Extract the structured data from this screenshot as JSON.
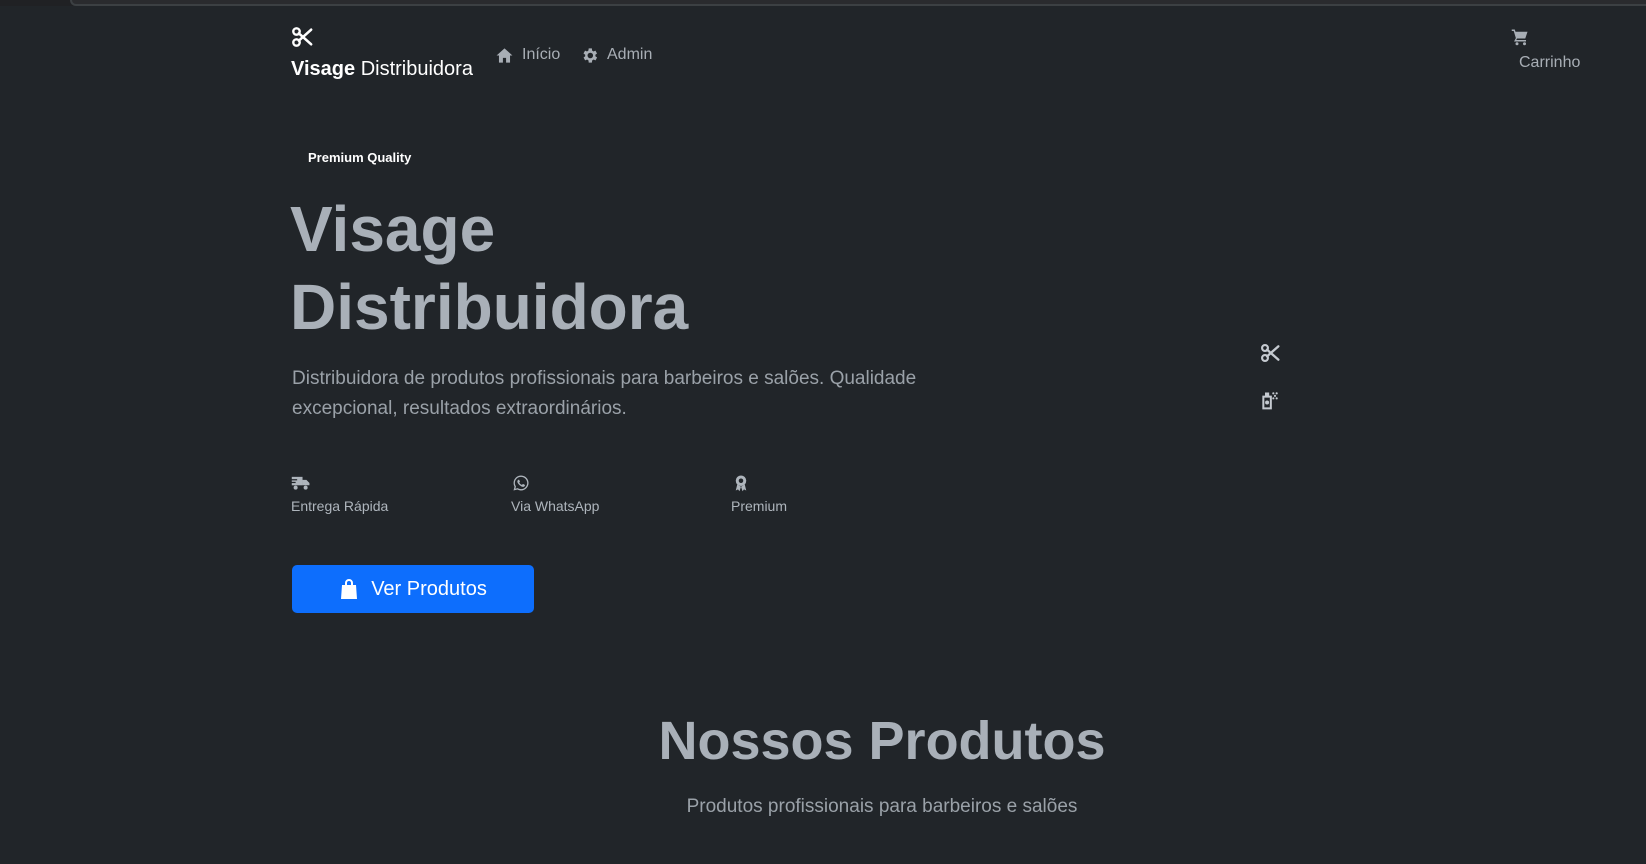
{
  "navbar": {
    "brand_bold": "Visage",
    "brand_rest": "Distribuidora",
    "links": [
      {
        "label": "Início",
        "icon": "home-icon"
      },
      {
        "label": "Admin",
        "icon": "gear-icon"
      }
    ],
    "cart_label": "Carrinho"
  },
  "hero": {
    "badge": "Premium Quality",
    "title_line1": "Visage",
    "title_line2": "Distribuidora",
    "description": "Distribuidora de produtos profissionais para barbeiros e salões. Qualidade excepcional, resultados extraordinários.",
    "features": [
      {
        "label": "Entrega Rápida",
        "icon": "truck-icon"
      },
      {
        "label": "Via WhatsApp",
        "icon": "whatsapp-icon"
      },
      {
        "label": "Premium",
        "icon": "award-icon"
      }
    ],
    "cta_label": "Ver Produtos"
  },
  "products": {
    "title": "Nossos Produtos",
    "subtitle": "Produtos profissionais para barbeiros e salões"
  },
  "colors": {
    "background": "#212529",
    "primary": "#0d6efd",
    "text_muted": "#adb5bd"
  }
}
